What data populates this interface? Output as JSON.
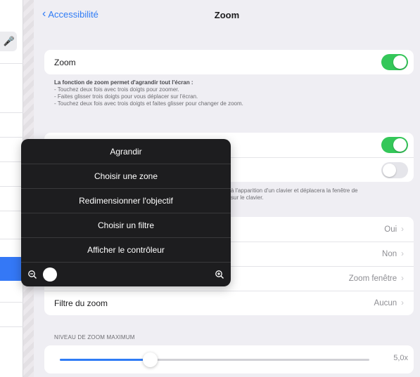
{
  "nav": {
    "back_label": "Accessibilité",
    "title": "Zoom"
  },
  "zoom_row": {
    "label": "Zoom",
    "on": true
  },
  "zoom_description": [
    "La fonction de zoom permet d'agrandir tout l'écran :",
    "- Touchez deux fois avec trois doigts pour zoomer.",
    "- Faites glisser trois doigts pour vous déplacer sur l'écran.",
    "- Touchez deux fois avec trois doigts et faites glisser pour changer de zoom."
  ],
  "toggle2": {
    "on": true
  },
  "toggle3": {
    "on": false
  },
  "partial_description": [
    "à l'apparition d'un clavier et déplacera la fenêtre de",
    "sur le clavier."
  ],
  "settings_rows": [
    {
      "label": "",
      "value": "Oui"
    },
    {
      "label": "",
      "value": "Non"
    },
    {
      "label": "",
      "value": "Zoom fenêtre"
    },
    {
      "label": "Filtre du zoom",
      "value": "Aucun"
    }
  ],
  "max_zoom": {
    "header": "NIVEAU DE ZOOM MAXIMUM",
    "value_label": "5,0x",
    "fraction": 0.29
  },
  "popup_menu": {
    "items": [
      "Agrandir",
      "Choisir une zone",
      "Redimensionner l'objectif",
      "Choisir un filtre",
      "Afficher le contrôleur"
    ],
    "zoom_fraction": 0.0
  },
  "colors": {
    "accent": "#2f7cf6",
    "toggle_on": "#34c759",
    "popup_bg": "#1d1d1f"
  }
}
